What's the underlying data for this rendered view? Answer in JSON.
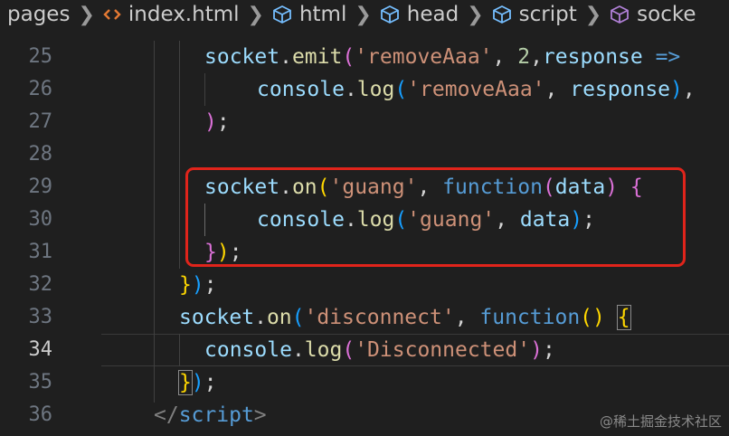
{
  "breadcrumb": [
    {
      "label": "pages",
      "icon": ""
    },
    {
      "label": "index.html",
      "icon": "html-file-icon"
    },
    {
      "label": "html",
      "icon": "element-cube-icon"
    },
    {
      "label": "head",
      "icon": "element-cube-icon"
    },
    {
      "label": "script",
      "icon": "element-cube-icon"
    },
    {
      "label": "socke",
      "icon": "element-cube-icon"
    }
  ],
  "editor": {
    "active_line": "34",
    "highlight_color": "#e0241b",
    "lines": [
      {
        "num": "25",
        "t0": "socket",
        "t1": ".",
        "t2": "emit",
        "t3": "(",
        "t4": "'removeAaa'",
        "t5": ", ",
        "t6": "2",
        "t7": ",",
        "t8": "response",
        "t9": " =>"
      },
      {
        "num": "26",
        "t0": "console",
        "t1": ".",
        "t2": "log",
        "t3": "(",
        "t4": "'removeAaa'",
        "t5": ", ",
        "t6": "response",
        "t7": ")",
        "t8": ","
      },
      {
        "num": "27",
        "t0": ")",
        "t1": ";"
      },
      {
        "num": "28"
      },
      {
        "num": "29",
        "t0": "socket",
        "t1": ".",
        "t2": "on",
        "t3": "(",
        "t4": "'guang'",
        "t5": ", ",
        "t6": "function",
        "t7": "(",
        "t8": "data",
        "t9": ")",
        "t10": " {"
      },
      {
        "num": "30",
        "t0": "console",
        "t1": ".",
        "t2": "log",
        "t3": "(",
        "t4": "'guang'",
        "t5": ", ",
        "t6": "data",
        "t7": ")",
        "t8": ";"
      },
      {
        "num": "31",
        "t0": "}",
        "t1": ")",
        "t2": ";"
      },
      {
        "num": "32",
        "t0": "}",
        "t1": ")",
        "t2": ";"
      },
      {
        "num": "33",
        "t0": "socket",
        "t1": ".",
        "t2": "on",
        "t3": "(",
        "t4": "'disconnect'",
        "t5": ", ",
        "t6": "function",
        "t7": "(",
        "t8": ")",
        "t9": " ",
        "t10": "{"
      },
      {
        "num": "34",
        "t0": "console",
        "t1": ".",
        "t2": "log",
        "t3": "(",
        "t4": "'Disconnected'",
        "t5": ")",
        "t6": ";"
      },
      {
        "num": "35",
        "t0": "}",
        "t1": ")",
        "t2": ";"
      },
      {
        "num": "36",
        "t0": "</",
        "t1": "script",
        "t2": ">"
      }
    ]
  },
  "watermark": "@稀土掘金技术社区"
}
